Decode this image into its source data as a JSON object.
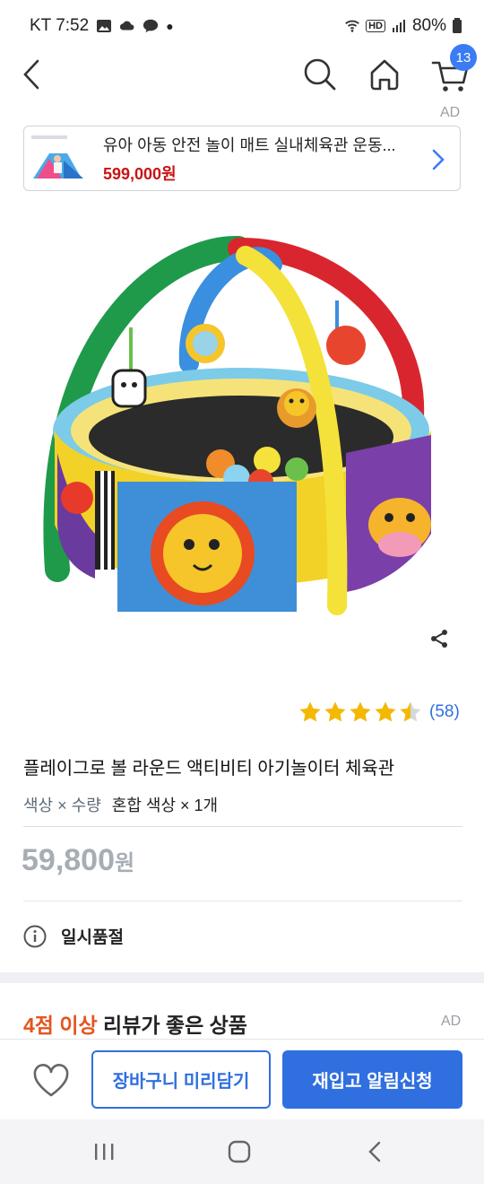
{
  "status_bar": {
    "carrier_time": "KT 7:52",
    "battery": "80%",
    "hd": "HD"
  },
  "nav": {
    "cart_count": "13"
  },
  "ad_banner": {
    "ad_label": "AD",
    "title": "유아 아동 안전 놀이 매트 실내체육관 운동...",
    "price": "599,000원"
  },
  "product": {
    "rating_value": 4.5,
    "rating_count": "(58)",
    "title": "플레이그로 볼 라운드 액티비티 아기놀이터 체육관",
    "option_key": "색상 × 수량",
    "option_value": "혼합 색상 × 1개",
    "price": "59,800",
    "price_unit": "원",
    "status": "일시품절"
  },
  "reviews_section": {
    "highlight": "4점 이상",
    "rest": " 리뷰가 좋은 상품",
    "ad_label": "AD"
  },
  "bottom_bar": {
    "cart_button": "장바구니 미리담기",
    "restock_button": "재입고 알림신청"
  },
  "colors": {
    "accent": "#2f6fe0",
    "badge": "#3b7cf5",
    "price_red": "#c81414",
    "highlight": "#e4551f",
    "star": "#f5b800"
  }
}
